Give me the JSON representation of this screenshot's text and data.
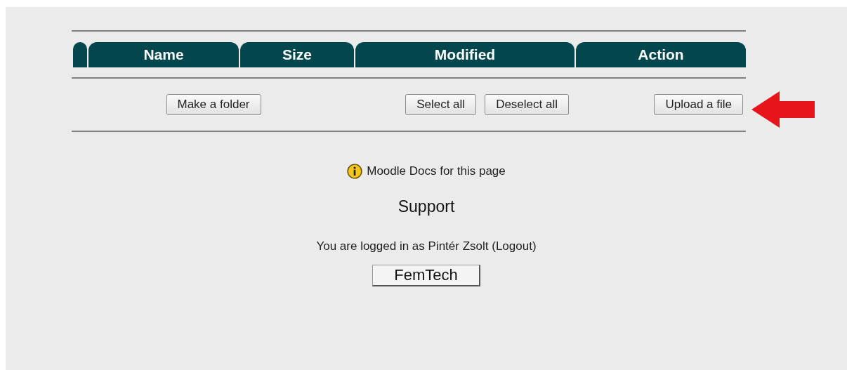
{
  "table": {
    "columns": [
      "Name",
      "Size",
      "Modified",
      "Action"
    ]
  },
  "actions": {
    "folder_button": "Make a folder",
    "select_buttons": [
      "Select all",
      "Deselect all"
    ],
    "upload_button": "Upload a file"
  },
  "docs_link": "Moodle Docs for this page",
  "footer": {
    "title": "Support",
    "login_info": "You are logged in as Pintér Zsolt (Logout)",
    "home_button": "FemTech"
  }
}
